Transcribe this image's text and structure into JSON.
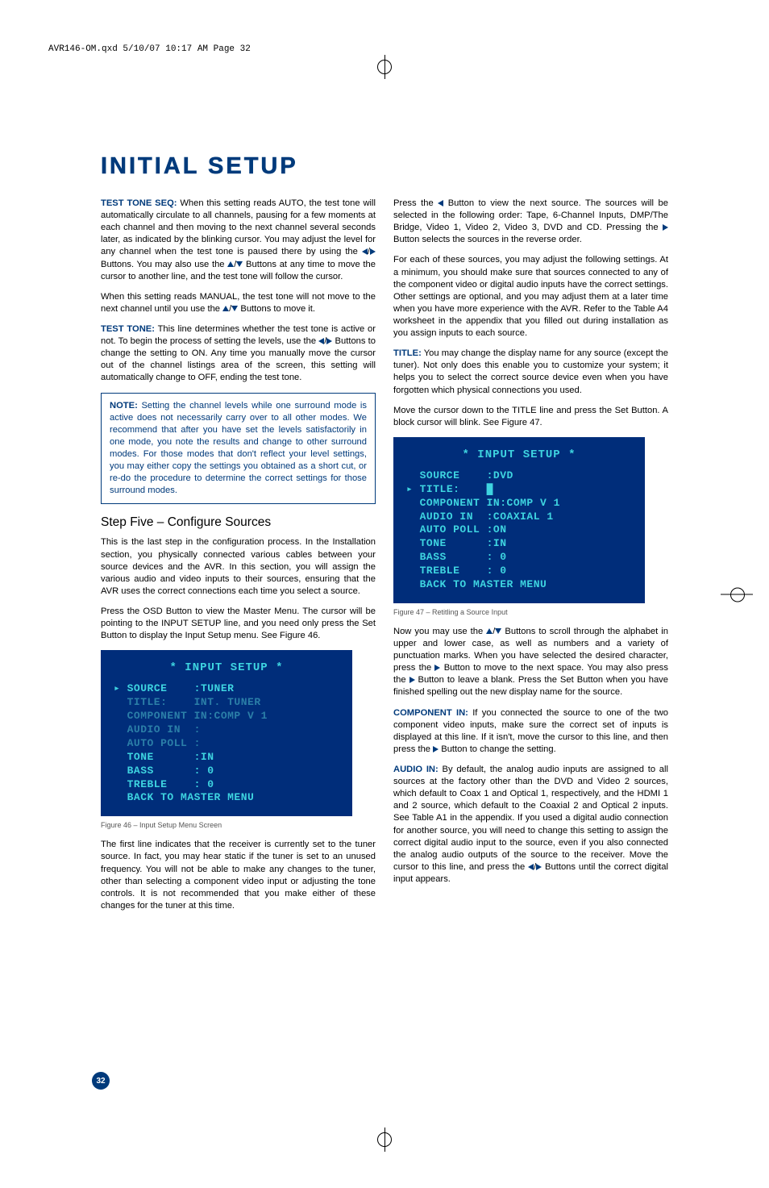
{
  "meta_header": "AVR146-OM.qxd  5/10/07  10:17 AM  Page 32",
  "page_number": "32",
  "title": "INITIAL SETUP",
  "left": {
    "p1_run": "TEST TONE SEQ:",
    "p1": " When this setting reads AUTO, the test tone will automatically circulate to all channels, pausing for a few moments at each channel and then moving to the next channel several seconds later, as indicated by the blinking cursor. You may adjust the level for any channel when the test tone is paused there by using the ",
    "p1b": " Buttons. You may also use the ",
    "p1c": " Buttons at any time to move the cursor to another line, and the test tone will follow the cursor.",
    "p2a": "When this setting reads MANUAL, the test tone will not move to the next channel until you use the ",
    "p2b": " Buttons to move it.",
    "p3_run": "TEST TONE:",
    "p3a": " This line determines whether the test tone is active or not. To begin the process of setting the levels, use the ",
    "p3b": " Buttons to change the setting to ON. Any time you manually move the cursor out of the channel listings area of the screen, this setting will automatically change to OFF, ending the test tone.",
    "note_run": "NOTE:",
    "note": " Setting the channel levels while one surround mode is active does not necessarily carry over to all other modes. We recommend that after you have set the levels satisfactorily in one mode, you note the results and change to other surround modes. For those modes that don't reflect your level settings, you may either copy the settings you obtained as a short cut, or re-do the procedure to determine the correct settings for those surround modes.",
    "h2": "Step Five – Configure Sources",
    "p4": "This is the last step in the configuration process. In the Installation section, you physically connected various cables between your source devices and the AVR. In this section, you will assign the various audio and video inputs to their sources, ensuring that the AVR uses the correct connections each time you select a source.",
    "p5": "Press the OSD Button to view the Master Menu. The cursor will be pointing to the INPUT SETUP line, and you need only press the Set Button to display the Input Setup menu. See Figure 46.",
    "osd1": {
      "header": "* INPUT SETUP *",
      "rows": [
        {
          "ptr": "▸",
          "l": "SOURCE",
          "r": ":TUNER"
        },
        {
          "ptr": " ",
          "l": "TITLE:",
          "r": "INT. TUNER",
          "dim": true
        },
        {
          "ptr": " ",
          "l": "COMPONENT",
          "r": "IN:COMP V 1",
          "dim": true
        },
        {
          "ptr": " ",
          "l": "AUDIO IN",
          "r": ":",
          "dim": true
        },
        {
          "ptr": " ",
          "l": "AUTO POLL",
          "r": ":",
          "dim": true
        },
        {
          "ptr": " ",
          "l": "TONE",
          "r": ":IN"
        },
        {
          "ptr": " ",
          "l": "BASS",
          "r": ": 0"
        },
        {
          "ptr": " ",
          "l": "TREBLE",
          "r": ": 0"
        },
        {
          "ptr": " ",
          "l": "BACK TO MASTER MENU",
          "r": ""
        }
      ]
    },
    "caption1": "Figure 46 –  Input Setup Menu Screen",
    "p6": "The first line indicates that the receiver is currently set to the tuner source. In fact, you may hear static if the tuner is set to an unused frequency. You will not be able to make any changes to the tuner, other than selecting a component video input or adjusting the tone controls. It is not recommended that you make either of these changes for the tuner at this time."
  },
  "right": {
    "p1a": "Press the ",
    "p1b": " Button to view the next source. The sources will be selected in the following order: Tape, 6-Channel Inputs, DMP/The Bridge, Video 1, Video 2, Video 3, DVD and CD. Pressing the ",
    "p1c": " Button selects the sources in the reverse order.",
    "p2": "For each of these sources, you may adjust the following settings. At a minimum, you should make sure that sources connected to any of the component video or digital audio inputs have the correct settings. Other settings are optional, and you may adjust them at a later time when you have more experience with the AVR. Refer to the Table A4 worksheet in the appendix that you filled out during installation as you assign inputs to each source.",
    "p3_run": "TITLE:",
    "p3": " You may change the display name for any source (except the tuner). Not only does this enable you to customize your system; it helps you to select the correct source device even when you have forgotten which physical connections you used.",
    "p4": "Move the cursor down to the TITLE line and press the Set Button. A block cursor will blink. See Figure 47.",
    "osd2": {
      "header": "* INPUT SETUP *",
      "rows": [
        {
          "ptr": " ",
          "l": "SOURCE",
          "r": ":DVD"
        },
        {
          "ptr": "▸",
          "l": "TITLE:",
          "r": "█"
        },
        {
          "ptr": " ",
          "l": "COMPONENT",
          "r": "IN:COMP V 1"
        },
        {
          "ptr": " ",
          "l": "AUDIO IN",
          "r": ":COAXIAL 1"
        },
        {
          "ptr": " ",
          "l": "AUTO POLL",
          "r": ":ON"
        },
        {
          "ptr": " ",
          "l": "TONE",
          "r": ":IN"
        },
        {
          "ptr": " ",
          "l": "BASS",
          "r": ": 0"
        },
        {
          "ptr": " ",
          "l": "TREBLE",
          "r": ": 0"
        },
        {
          "ptr": " ",
          "l": "BACK TO MASTER MENU",
          "r": ""
        }
      ]
    },
    "caption2": "Figure 47 – Retitling a Source Input",
    "p5a": "Now you may use the ",
    "p5b": " Buttons to scroll through the alphabet in upper and lower case, as well as numbers and a variety of punctuation marks. When you have selected the desired character, press the ",
    "p5c": " Button to move to the next space. You may also press the ",
    "p5d": " Button to leave a blank. Press the Set Button when you have finished spelling out the new display name for the source.",
    "p6_run": "COMPONENT IN:",
    "p6a": " If you connected the source to one of the two component video inputs, make sure the correct set of inputs is displayed at this line. If it isn't, move the cursor to this line, and then press the ",
    "p6b": " Button to change the setting.",
    "p7_run": "AUDIO IN:",
    "p7a": " By default, the analog audio inputs are assigned to all sources at the factory other than the DVD and Video 2 sources, which default to Coax 1 and Optical 1, respectively, and the HDMI 1 and 2 source, which default to the Coaxial 2 and Optical 2 inputs. See Table A1 in the appendix. If you used a digital audio connection for another source, you will need to change this setting to assign the correct digital audio input to the source, even if you also connected the analog audio outputs of the source to the receiver. Move the cursor to this line, and press the ",
    "p7b": " Buttons until the correct digital input appears."
  }
}
